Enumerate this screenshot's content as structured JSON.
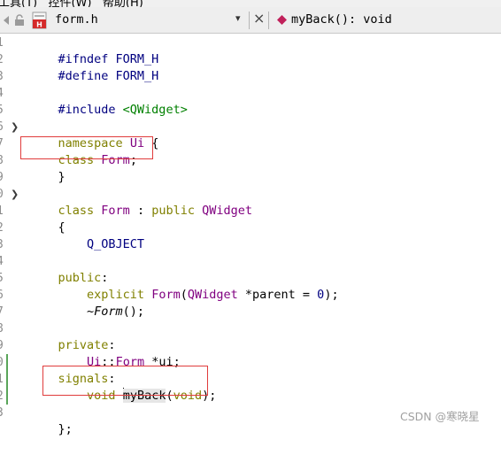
{
  "menubar": {
    "text": "工具(T)   控件(W)   帮助(H)"
  },
  "tab": {
    "file_name": "form.h",
    "function": "myBack(): void",
    "dropdown": "▾",
    "close": "×"
  },
  "gutter": {
    "numbers": [
      "1",
      "2",
      "3",
      "4",
      "5",
      "6",
      "7",
      "8",
      "9",
      "0",
      "1",
      "2",
      "3",
      "4",
      "5",
      "6",
      "7",
      "8",
      "9",
      "0",
      "1",
      "2",
      "3"
    ]
  },
  "code": {
    "l1": {
      "a": "#ifndef FORM_H"
    },
    "l2": {
      "a": "#define FORM_H"
    },
    "l4": {
      "a": "#include ",
      "b": "<QWidget>"
    },
    "l6": {
      "a": "namespace",
      "b": " ",
      "c": "Ui",
      "d": " {"
    },
    "l7": {
      "a": "class",
      "b": " ",
      "c": "Form",
      "d": ";"
    },
    "l8": {
      "a": "}"
    },
    "l10": {
      "a": "class",
      "b": " ",
      "c": "Form",
      "d": " : ",
      "e": "public",
      "f": " ",
      "g": "QWidget"
    },
    "l11": {
      "a": "{"
    },
    "l12": {
      "a": "    ",
      "b": "Q_OBJECT"
    },
    "l14": {
      "a": "public",
      "b": ":"
    },
    "l15": {
      "a": "    ",
      "b": "explicit",
      "c": " ",
      "d": "Form",
      "e": "(",
      "f": "QWidget",
      "g": " *parent = ",
      "h": "0",
      "i": ");"
    },
    "l16": {
      "a": "    ~",
      "b": "Form",
      "c": "();"
    },
    "l18": {
      "a": "private",
      "b": ":"
    },
    "l19": {
      "a": "    ",
      "b": "Ui",
      "c": "::",
      "d": "Form",
      "e": " *ui;"
    },
    "l20": {
      "a": "signals",
      "b": ":"
    },
    "l21": {
      "a": "    ",
      "b": "void",
      "c": " ",
      "d": "myBack",
      "e": "(",
      "f": "void",
      "g": ");"
    },
    "l23": {
      "a": "};"
    }
  },
  "watermark": "CSDN @寒晓星",
  "colors": {
    "keyword": "#808000",
    "type": "#800080",
    "string": "#008000",
    "macro": "#000080",
    "annotation": "#e03c3c"
  }
}
